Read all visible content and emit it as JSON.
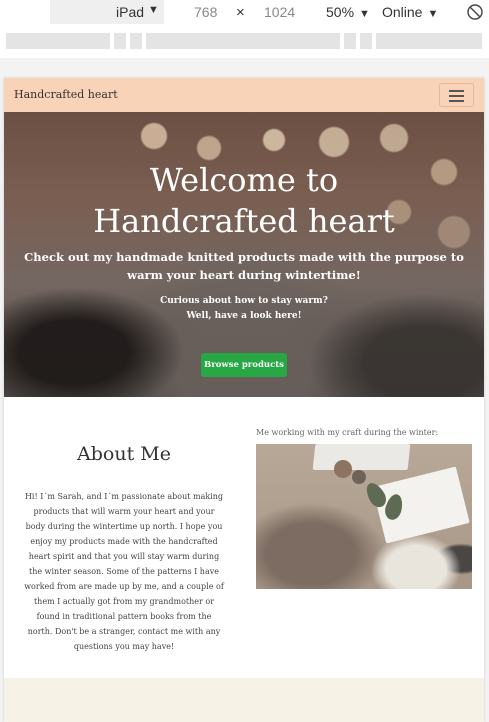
{
  "devtools": {
    "device": "iPad",
    "width": "768",
    "times": "×",
    "height": "1024",
    "zoom": "50%",
    "network": "Online"
  },
  "icons": {
    "caret": "caret-down-icon",
    "rotate": "rotate-icon",
    "menu": "hamburger-menu-icon"
  },
  "colors": {
    "navbar": "#f9d3b7",
    "button": "#28a745",
    "next_section": "#f6f3e6"
  },
  "site": {
    "brand": "Handcrafted heart",
    "hero": {
      "title_line1": "Welcome to",
      "title_line2": "Handcrafted heart",
      "subtitle": "Check out my handmade knitted products made with the purpose to warm your heart during wintertime!",
      "question_line1": "Curious about how to stay warm?",
      "question_line2": "Well, have a look here!",
      "button": "Browse products"
    },
    "about": {
      "title": "About Me",
      "text": "Hi! I´m Sarah, and I´m passionate about making products that will warm your heart and your body during the wintertime up north. I hope you enjoy my products made with the handcrafted heart spirit and that you will stay warm during the winter season. Some of the patterns I have worked from are made up by me, and a couple of them I actually got from my grandmother or found in traditional pattern books from the north. Don't be a stranger, contact me with any questions you may have!",
      "caption": "Me working with my craft during the winter:"
    }
  }
}
